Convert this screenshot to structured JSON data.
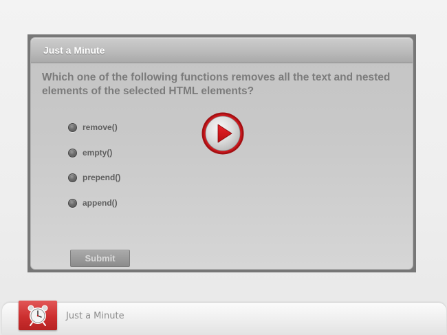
{
  "quiz": {
    "title": "Just a Minute",
    "question": "Which one of the following functions removes all the text and nested elements of the selected HTML elements?",
    "options": [
      {
        "label": "remove()"
      },
      {
        "label": "empty()"
      },
      {
        "label": "prepend()"
      },
      {
        "label": "append()"
      }
    ],
    "submit_label": "Submit"
  },
  "play_button": {
    "icon": "play-icon",
    "ring_color": "#a30f12",
    "triangle_color": "#d11016"
  },
  "footer": {
    "icon": "alarm-clock-icon",
    "icon_bg_color": "#cc2f2f",
    "title": "Just a Minute"
  }
}
